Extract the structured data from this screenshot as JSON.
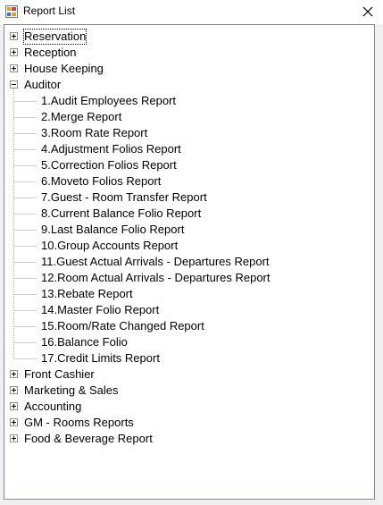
{
  "window": {
    "title": "Report List",
    "icon": "report-list-app-icon",
    "close_icon": "close-icon"
  },
  "tree": {
    "selected": "Reservation",
    "nodes": [
      {
        "label": "Reservation",
        "expanded": false,
        "children": []
      },
      {
        "label": "Reception",
        "expanded": false,
        "children": []
      },
      {
        "label": "House Keeping",
        "expanded": false,
        "children": []
      },
      {
        "label": "Auditor",
        "expanded": true,
        "children": [
          "1.Audit Employees Report",
          "2.Merge Report",
          "3.Room Rate Report",
          "4.Adjustment Folios Report",
          "5.Correction Folios Report",
          "6.Moveto Folios Report",
          "7.Guest - Room Transfer Report",
          "8.Current Balance Folio Report",
          "9.Last Balance Folio Report",
          "10.Group Accounts Report",
          "11.Guest Actual Arrivals - Departures Report",
          "12.Room Actual Arrivals - Departures Report",
          "13.Rebate Report",
          "14.Master Folio Report",
          "15.Room/Rate Changed Report",
          "16.Balance Folio",
          "17.Credit Limits Report"
        ]
      },
      {
        "label": "Front Cashier",
        "expanded": false,
        "children": []
      },
      {
        "label": "Marketing & Sales",
        "expanded": false,
        "children": []
      },
      {
        "label": "Accounting",
        "expanded": false,
        "children": []
      },
      {
        "label": "GM - Rooms Reports",
        "expanded": false,
        "children": []
      },
      {
        "label": "Food & Beverage Report",
        "expanded": false,
        "children": []
      }
    ]
  }
}
